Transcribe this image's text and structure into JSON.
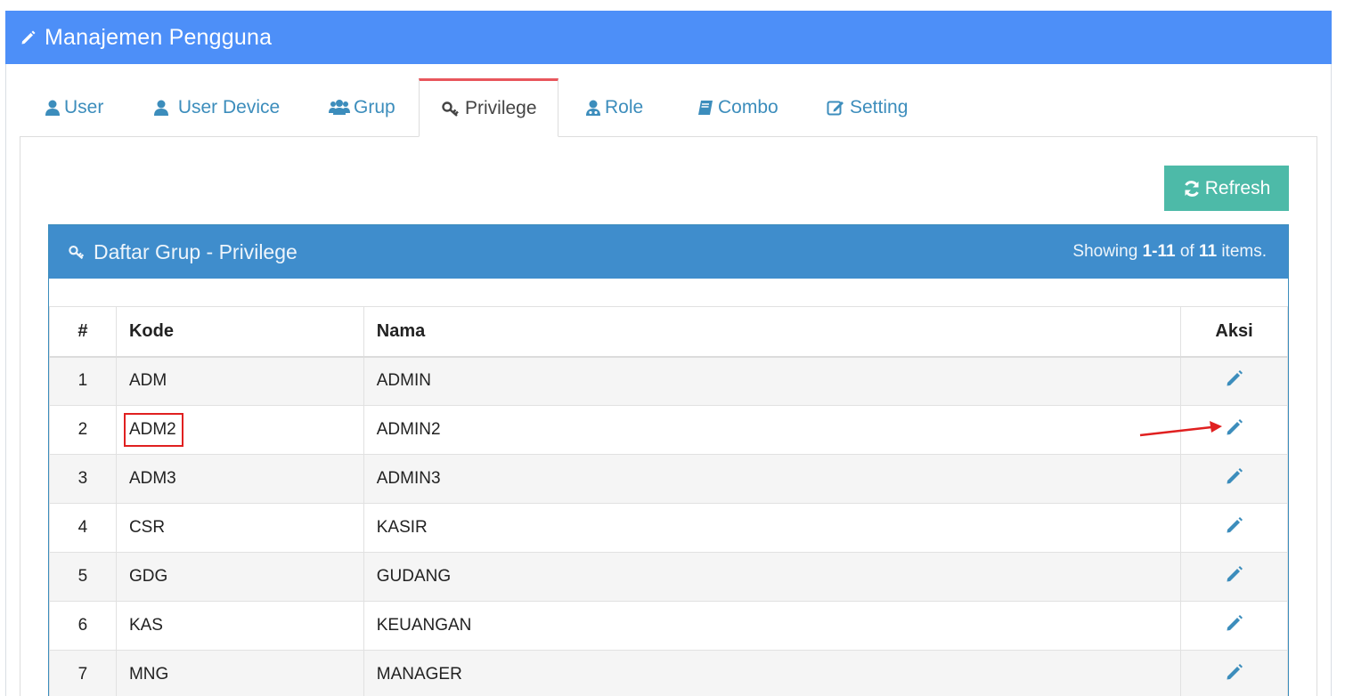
{
  "header": {
    "title": "Manajemen Pengguna",
    "icon": "pencil-icon"
  },
  "tabs": [
    {
      "label": "User",
      "icon": "user-icon",
      "active": false
    },
    {
      "label": " User Device",
      "icon": "user-icon",
      "active": false
    },
    {
      "label": "Grup",
      "icon": "users-icon",
      "active": false
    },
    {
      "label": "Privilege",
      "icon": "key-icon",
      "active": true
    },
    {
      "label": "Role",
      "icon": "user-md-icon",
      "active": false
    },
    {
      "label": "Combo",
      "icon": "book-icon",
      "active": false
    },
    {
      "label": "Setting",
      "icon": "edit-icon",
      "active": false
    }
  ],
  "refresh_label": "Refresh",
  "box": {
    "title": "Daftar Grup - Privilege",
    "summary_prefix": "Showing ",
    "summary_range": "1-11",
    "summary_mid": " of ",
    "summary_total": "11",
    "summary_suffix": " items."
  },
  "table": {
    "headers": {
      "no": "#",
      "kode": "Kode",
      "nama": "Nama",
      "aksi": "Aksi"
    },
    "rows": [
      {
        "no": "1",
        "kode": "ADM",
        "nama": "ADMIN"
      },
      {
        "no": "2",
        "kode": "ADM2",
        "nama": "ADMIN2"
      },
      {
        "no": "3",
        "kode": "ADM3",
        "nama": "ADMIN3"
      },
      {
        "no": "4",
        "kode": "CSR",
        "nama": "KASIR"
      },
      {
        "no": "5",
        "kode": "GDG",
        "nama": "GUDANG"
      },
      {
        "no": "6",
        "kode": "KAS",
        "nama": "KEUANGAN"
      },
      {
        "no": "7",
        "kode": "MNG",
        "nama": "MANAGER"
      }
    ]
  },
  "colors": {
    "header_bg": "#4d8ff8",
    "box_head_bg": "#3f8dcc",
    "refresh_bg": "#4dbaa8",
    "active_tab_border": "#e8565c",
    "annotation": "#e02020",
    "link": "#3c8dbc"
  }
}
